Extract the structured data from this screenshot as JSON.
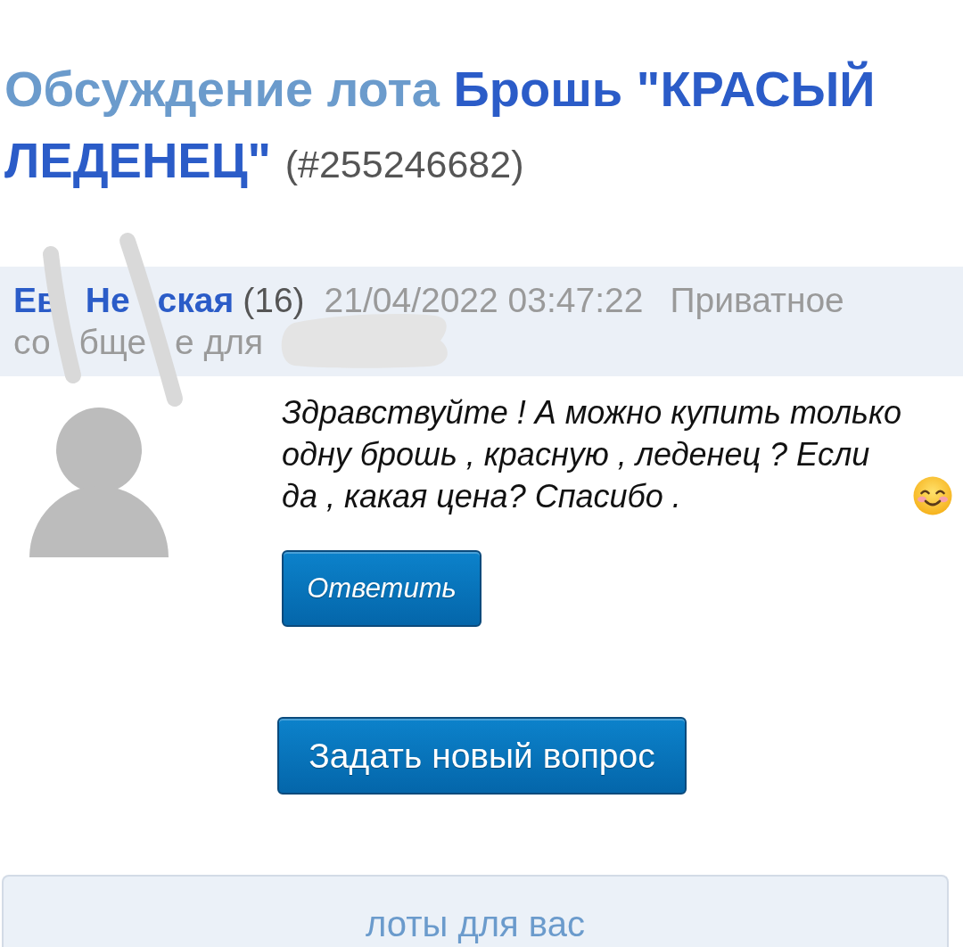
{
  "title": {
    "prefix": "Обсуждение лота",
    "lot_name": "Брошь \"КРАСЫЙ ЛЕДЕНЕЦ\"",
    "lot_number": "(#255246682)"
  },
  "message": {
    "author_fragments": [
      "Ев",
      "Не",
      "ская"
    ],
    "rating": "(16)",
    "date": "21/04/2022 03:47:22",
    "note_rows": [
      [
        "Приватное"
      ],
      [
        "со",
        "бще",
        "е для"
      ]
    ],
    "text": "Здравствуйте ! А можно купить только одну брошь , красную , леденец ? Если да , какая цена? Спасибо .",
    "reply_button": "Ответить"
  },
  "ask_button": "Задать новый вопрос",
  "recommendations": {
    "title": "лоты для вас"
  }
}
